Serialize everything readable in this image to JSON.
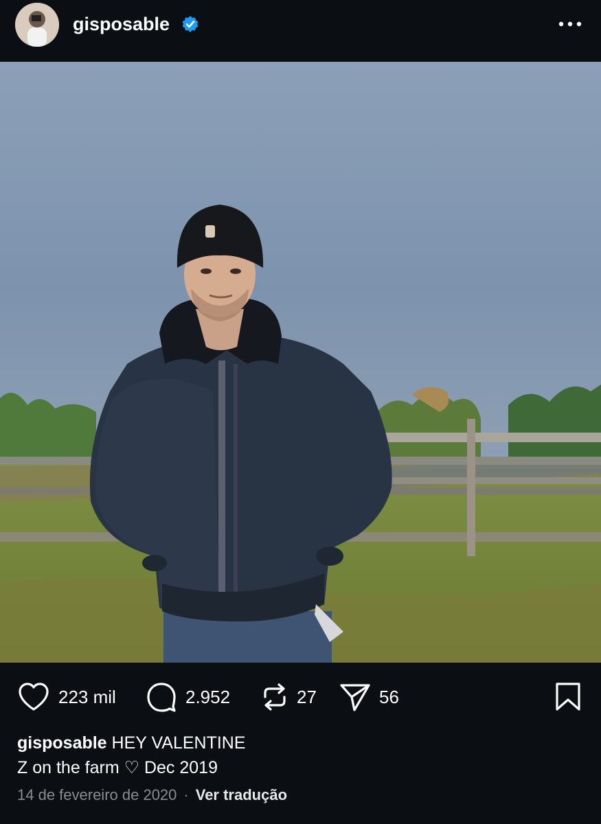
{
  "header": {
    "username": "gisposable",
    "verified": true,
    "avatar_icon": "avatar-photo",
    "more_icon": "more-options-icon"
  },
  "post": {
    "image_alt": "photo",
    "stats": {
      "likes": "223 mil",
      "comments": "2.952",
      "reposts": "27",
      "shares": "56"
    },
    "caption": {
      "author": "gisposable",
      "line1": "HEY VALENTINE",
      "line2": "Z on the farm ♡ Dec 2019"
    },
    "date": "14 de fevereiro de 2020",
    "separator": "·",
    "translate_label": "Ver tradução"
  },
  "colors": {
    "background": "#0b0f14",
    "verified_badge": "#1d9bf0",
    "muted_text": "#8a8d91"
  }
}
